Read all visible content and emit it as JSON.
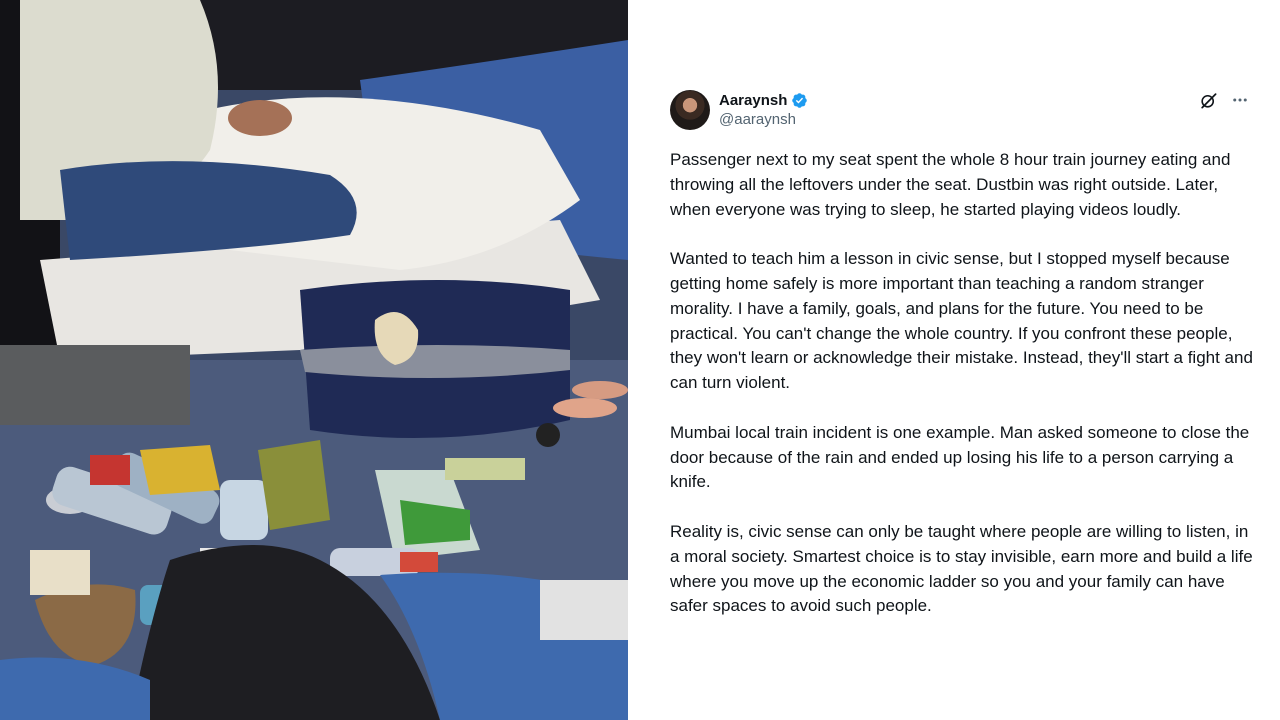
{
  "post": {
    "author": {
      "display_name": "Aaraynsh",
      "handle": "@aaraynsh",
      "verified": true
    },
    "icons": {
      "grok": "grok-slash-icon",
      "more": "more-icon",
      "verified": "verified-badge-icon"
    },
    "colors": {
      "verified_blue": "#1d9bf0",
      "text": "#0f1419",
      "secondary_text": "#536471"
    },
    "paragraphs": [
      "Passenger next to my seat spent the whole 8 hour train journey eating and throwing all the leftovers under the seat. Dustbin was right outside. Later, when everyone was trying to sleep, he started playing videos loudly.",
      "Wanted to teach him a lesson in civic sense, but I stopped myself because getting home safely is more important than teaching a random stranger morality. I have a family, goals, and plans for the future. You need to be practical. You can't change the whole country. If you confront these people, they won't learn or acknowledge their mistake. Instead, they'll start a fight and can turn violent.",
      "Mumbai local train incident is one example. Man asked someone to close the door because of the rain and ended up losing his life to a person carrying a knife.",
      "Reality is, civic sense can only be taught where people are willing to listen, in a moral society. Smartest choice is to stay invisible, earn more and build a life where you move up the economic ladder so you and your family can have safer spaces to avoid such people."
    ]
  }
}
